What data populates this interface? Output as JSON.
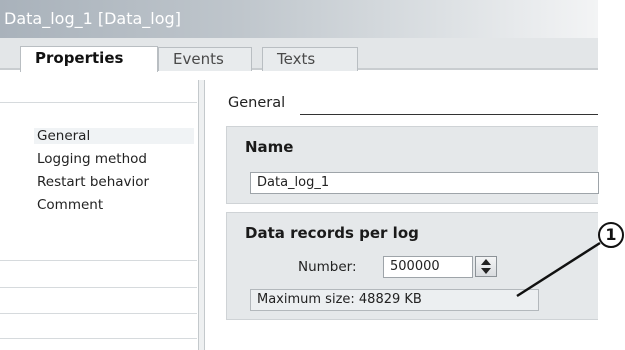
{
  "window": {
    "title": "Data_log_1 [Data_log]"
  },
  "tabs": [
    {
      "label": "Properties",
      "active": true
    },
    {
      "label": "Events",
      "active": false
    },
    {
      "label": "Texts",
      "active": false
    }
  ],
  "sidebar": {
    "items": [
      {
        "label": "General",
        "selected": true
      },
      {
        "label": "Logging method",
        "selected": false
      },
      {
        "label": "Restart behavior",
        "selected": false
      },
      {
        "label": "Comment",
        "selected": false
      }
    ]
  },
  "main": {
    "section_title": "General",
    "name_group": {
      "title": "Name",
      "value": "Data_log_1"
    },
    "records_group": {
      "title": "Data records per log",
      "number_label": "Number:",
      "number_value": "500000",
      "max_size": "Maximum size: 48829 KB"
    }
  },
  "callout": {
    "number": "1"
  }
}
